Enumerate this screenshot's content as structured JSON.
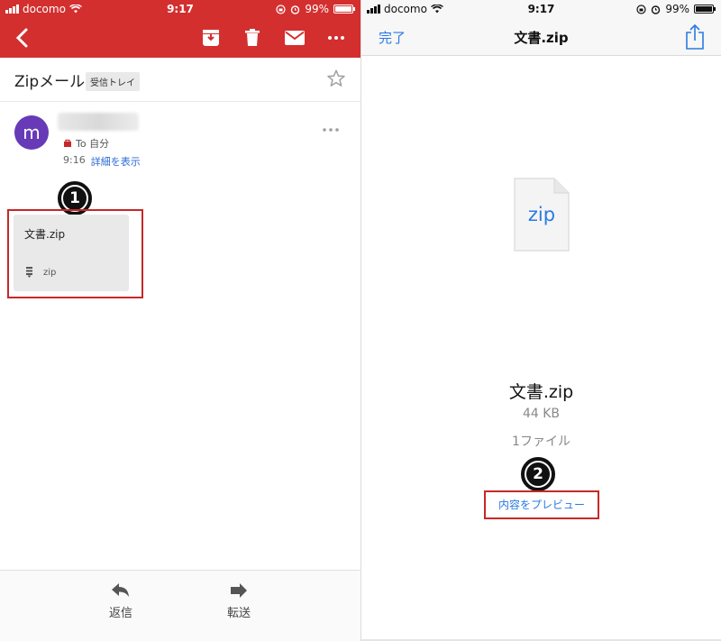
{
  "status": {
    "carrier": "docomo",
    "time": "9:17",
    "battery": "99%",
    "battery_level": 0.99
  },
  "gmail": {
    "subject": "Zipメール",
    "label": "受信トレイ",
    "sender_initial": "m",
    "to_text": "To 自分",
    "time": "9:16",
    "details_link": "詳細を表示",
    "attachment": {
      "name": "文書.zip",
      "type": "zip"
    },
    "bottom": {
      "reply_label": "返信",
      "forward_label": "転送"
    },
    "colors": {
      "header": "#d32f2f",
      "avatar": "#673ab7"
    }
  },
  "annotations": {
    "step1": "1",
    "step2": "2"
  },
  "quicklook": {
    "done_label": "完了",
    "title": "文書.zip",
    "icon_ext": "zip",
    "file_name": "文書.zip",
    "file_size": "44 KB",
    "file_count": "1ファイル",
    "preview_link": "内容をプレビュー",
    "colors": {
      "accent": "#2a7ae2"
    }
  }
}
